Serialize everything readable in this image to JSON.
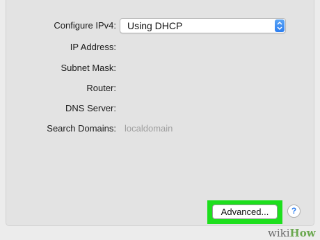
{
  "form": {
    "configure_ipv4_label": "Configure IPv4:",
    "configure_ipv4_value": "Using DHCP",
    "ip_address_label": "IP Address:",
    "subnet_mask_label": "Subnet Mask:",
    "router_label": "Router:",
    "dns_server_label": "DNS Server:",
    "search_domains_label": "Search Domains:",
    "search_domains_value": "localdomain"
  },
  "buttons": {
    "advanced_label": "Advanced...",
    "help_label": "?"
  },
  "watermark": {
    "wiki": "wiki",
    "how": "How"
  },
  "colors": {
    "highlight": "#1ddf1d",
    "accent": "#2d7ff0",
    "watermark_green": "#6aa84f"
  },
  "icons": {
    "select_stepper": "up-down-chevron-icon"
  }
}
